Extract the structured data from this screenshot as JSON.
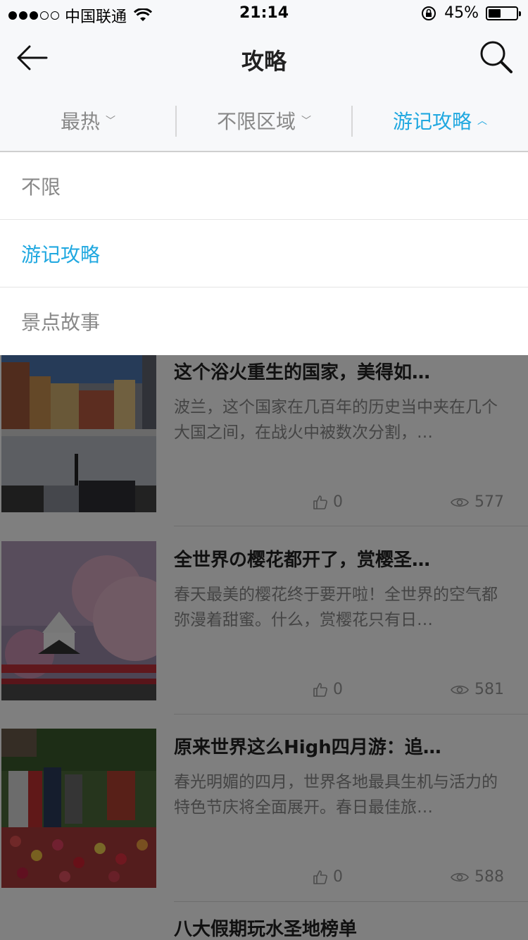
{
  "status_bar": {
    "carrier": "中国联通",
    "time": "21:14",
    "battery": "45%",
    "battery_level": 0.45
  },
  "nav": {
    "title": "攻略",
    "back_icon": "back-arrow-icon",
    "search_icon": "search-icon"
  },
  "filters": {
    "sort": "最热",
    "region": "不限区域",
    "category": "游记攻略"
  },
  "dropdown": {
    "items": [
      "不限",
      "游记攻略",
      "景点故事"
    ],
    "selected_index": 1
  },
  "articles": [
    {
      "title": "这个浴火重生的国家，美得如…",
      "desc": "波兰，这个国家在几百年的历史当中夹在几个大国之间，在战火中被数次分割，…",
      "likes": "0",
      "views": "577"
    },
    {
      "title": "全世界の樱花都开了，赏樱圣…",
      "desc": "春天最美的樱花终于要开啦！全世界的空气都弥漫着甜蜜。什么，赏樱花只有日…",
      "likes": "0",
      "views": "581"
    },
    {
      "title": "原来世界这么High四月游：追…",
      "desc": "春光明媚的四月，世界各地最具生机与活力的特色节庆将全面展开。春日最佳旅…",
      "likes": "0",
      "views": "588"
    },
    {
      "title": "八大假期玩水圣地榜单",
      "desc": "",
      "likes": "",
      "views": ""
    }
  ],
  "colors": {
    "accent": "#20a8e0",
    "bar_bg": "#f7f8fa",
    "muted": "#888888",
    "overlay": "rgba(0,0,0,0.5)"
  }
}
